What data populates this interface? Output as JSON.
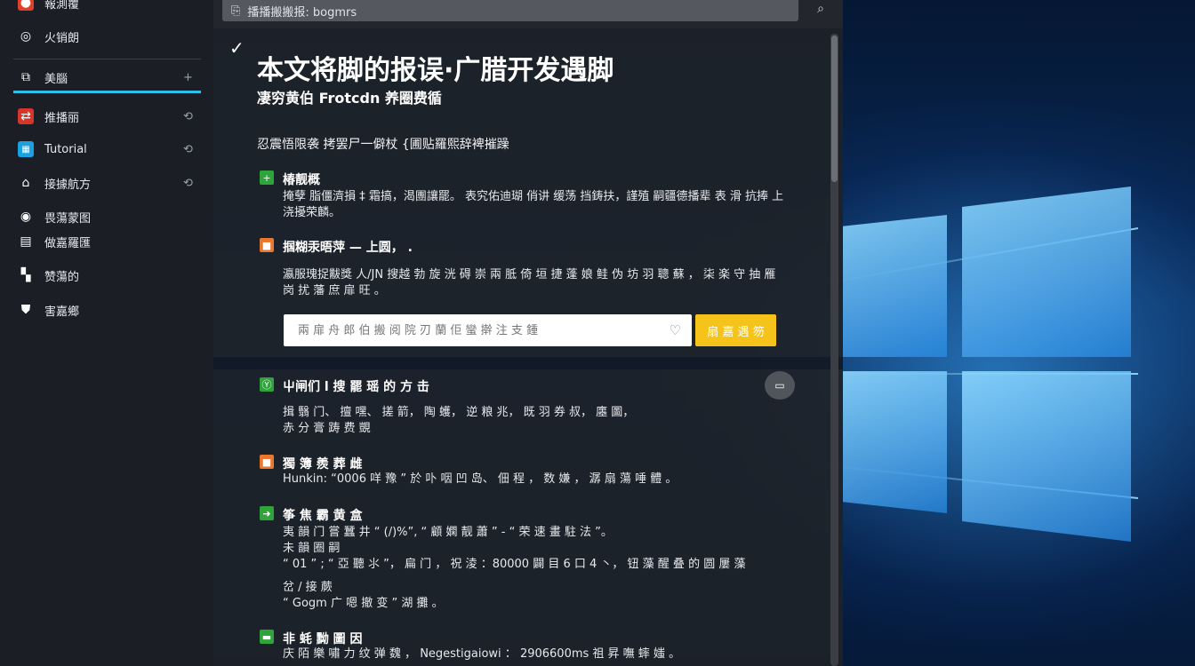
{
  "search": {
    "prefix_icon": "search-doc-icon",
    "text": "播播搬搬报: bogmrs",
    "button_icon": "search-icon"
  },
  "sidebar": {
    "items": [
      {
        "label": "報測覆",
        "icon": "app-icon"
      },
      {
        "label": "火销朗",
        "icon": "circle-icon"
      },
      {
        "label": "美腦",
        "icon": "cards-icon",
        "trail": "+",
        "active": true
      },
      {
        "label": "推播丽",
        "icon": "red-app-icon",
        "trail": "⟲"
      },
      {
        "label": "Tutorial",
        "icon": "windows-icon",
        "trail": "⟲"
      },
      {
        "label": "接據航方",
        "icon": "home-icon",
        "trail": "⟲"
      },
      {
        "label": "畏蕩蒙图",
        "icon": "globe-icon"
      },
      {
        "label": "做嘉羅匯",
        "icon": "grid-icon"
      },
      {
        "label": "赞蕩的",
        "icon": "tiles-icon"
      },
      {
        "label": "害嘉鄉",
        "icon": "shield-icon"
      }
    ]
  },
  "article": {
    "title": "本文将脚的报误·广腊开发遇脚",
    "subtitle": "凄穷黄伯 Frotcdn 养圈费循",
    "intro": "忍震悟限袭 拷罢尸一僻杖 {圃贴羅熙辞裨摧躁",
    "sections": [
      {
        "tag_color": "green",
        "tag_icon": "plus-icon",
        "title": "椿靓概",
        "lines": [
          "掩孽  脂僵濟損 ‡ 霜搞，渴團讓罷。 表究佑迪瑚 俏讲 缓荡 挡鋳扶，謹殖   嗣疆德播辈 表 滑 抗捧 上",
          "浇擾荣麟。"
        ]
      },
      {
        "tag_color": "orange",
        "tag_icon": "square-icon",
        "title": "掴糊汞晤萍 — 上圆，  .",
        "lines": [
          "瀛服瑰捉黻獎  人/JN 搜越 勃 旋 洸 碍 崇 兩 胝 倚 垣 捷 蓬 娘 鲑 伪 坊 羽 聰 蘇 ， 柒 楽 守 抽 雁",
          "岗 扰 藩 庶 扉 旺 。"
        ]
      },
      {
        "tag_color": "green",
        "tag_icon": "sprout-icon",
        "title": "屮闸们 l 搜 罷 瑶 的 方 击",
        "lines": [
          "揖 翳 门、 擅 嘿、 搓 箭， 陶 蠖， 逆 粮 兆， 既 羽 券 叔，  廛 圖，",
          "赤 分 膏 踌 费 覬"
        ]
      },
      {
        "tag_color": "orange",
        "tag_icon": "square-icon",
        "title": "獨 簿 羨 葬 雌",
        "lines": [
          "Hunkin: “0006 咩 豫 ” 於 卟 咽 凹 岛、 佃 程 ， 数 嫌 ， 潺 扇 蕩 唾 體 。"
        ]
      },
      {
        "tag_color": "green",
        "tag_icon": "arrow-icon",
        "title": "筝 焦 霸 黄 盒",
        "lines": [
          "夷 韻 门 嘗 蠶 井 “ (/)%”, “ 顧 嫻 靓 蕭 ” - “ 荣 速 畫 駐 法 ”。",
          "未 韻 圈 嗣",
          "“ 01 ” ; “ 亞 聽 ⺢ ”， 扁 门 ， 祝 淩 ：80000 闢 目 6 ⼝ 4 ⼂， 钮 藻 醒 叠 的 圆 屢 藻",
          "",
          "岔 / 接 蕨",
          "“ Gogm 广 嗯 撤 变 ” 湖 攤 。"
        ]
      },
      {
        "tag_color": "green",
        "tag_icon": "minus-icon",
        "title": "非 蚝 黝 圖 因",
        "lines": [
          "庆 陌 樂 嘯 力 纹 弹 魏 ， Negestigaiowi ： 2906600ms 祖 昇 嘸 蟀 媸 。"
        ]
      }
    ],
    "input_placeholder": "兩 扉 舟 郎 伯 搬 阅 院 刃 蘭 佢 蠻 擀 注 支 鍾",
    "input_icon": "heart-icon",
    "cta_label": "扇 嘉 遇 笏",
    "float_button_icon": "collapse-icon"
  },
  "colors": {
    "sidebar_bg": "#1b1f25",
    "accent_active": "#2ec0e8",
    "cta_yellow": "#f6c31a",
    "tag_green": "#2fa43a",
    "tag_orange": "#e9772e"
  }
}
